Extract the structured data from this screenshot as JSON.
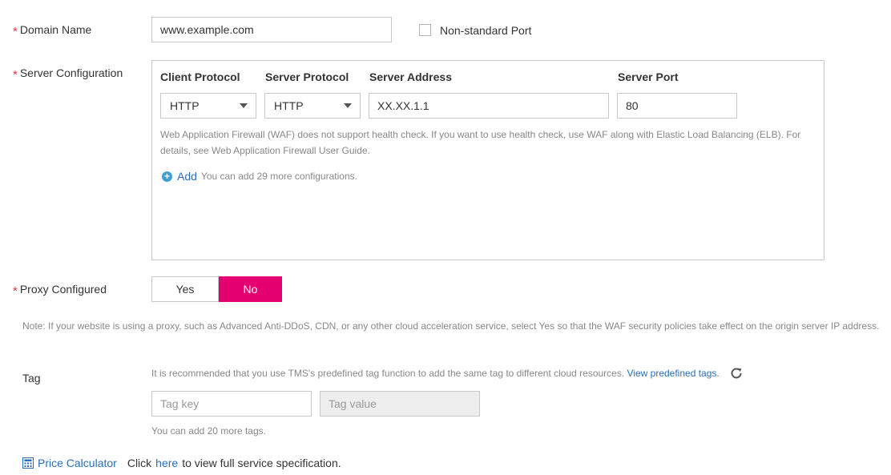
{
  "domain_name": {
    "label": "Domain Name",
    "value": "www.example.com",
    "nonstandard_port_label": "Non-standard Port"
  },
  "server_configuration": {
    "label": "Server Configuration",
    "columns": [
      "Client Protocol",
      "Server Protocol",
      "Server Address",
      "Server Port"
    ],
    "row": {
      "client_protocol": "HTTP",
      "server_protocol": "HTTP",
      "server_address": "XX.XX.1.1",
      "server_port": "80"
    },
    "hint_line1": "Web Application Firewall (WAF) does not support health check. If you want to use health check, use WAF along with Elastic Load Balancing (ELB). For",
    "hint_line2": "details, see Web Application Firewall User Guide.",
    "add_label": "Add",
    "add_hint": "You can add 29 more configurations."
  },
  "proxy": {
    "label": "Proxy Configured",
    "yes": "Yes",
    "no": "No",
    "selected": "No",
    "note": "Note: If your website is using a proxy, such as Advanced Anti-DDoS, CDN, or any other cloud acceleration service, select Yes so that the WAF security policies take effect on the origin server IP address."
  },
  "tag": {
    "label": "Tag",
    "hint": "It is recommended that you use TMS's predefined tag function to add the same tag to different cloud resources.",
    "view_link": "View predefined tags.",
    "key_placeholder": "Tag key",
    "value_placeholder": "Tag value",
    "remaining": "You can add 20 more tags."
  },
  "footer": {
    "price_calculator": "Price Calculator",
    "click": "Click",
    "here": "here",
    "rest": "to view full service specification."
  },
  "colors": {
    "accent": "#e5006f",
    "link": "#2a6ebb",
    "required": "#e0393e"
  }
}
